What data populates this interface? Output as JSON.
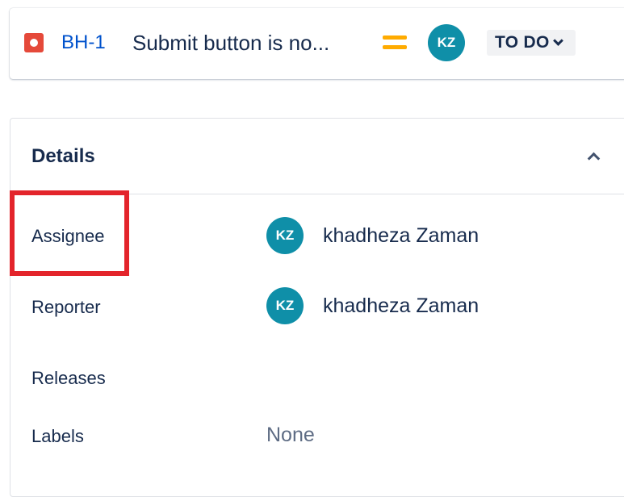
{
  "issue": {
    "type_icon": "bug-icon",
    "key": "BH-1",
    "summary": "Submit button is no...",
    "priority_icon": "priority-medium-icon",
    "priority_color": "#ffab00",
    "assignee_initials": "KZ",
    "status": "TO DO"
  },
  "details": {
    "title": "Details",
    "fields": {
      "assignee": {
        "label": "Assignee",
        "initials": "KZ",
        "name": "khadheza Zaman"
      },
      "reporter": {
        "label": "Reporter",
        "initials": "KZ",
        "name": "khadheza Zaman"
      },
      "releases": {
        "label": "Releases"
      },
      "labels": {
        "label": "Labels",
        "value": "None"
      }
    }
  },
  "colors": {
    "accent_link": "#0052cc",
    "avatar_bg": "#0f8fa8",
    "bug_red": "#e5493a",
    "highlight_red": "#e3242b"
  }
}
